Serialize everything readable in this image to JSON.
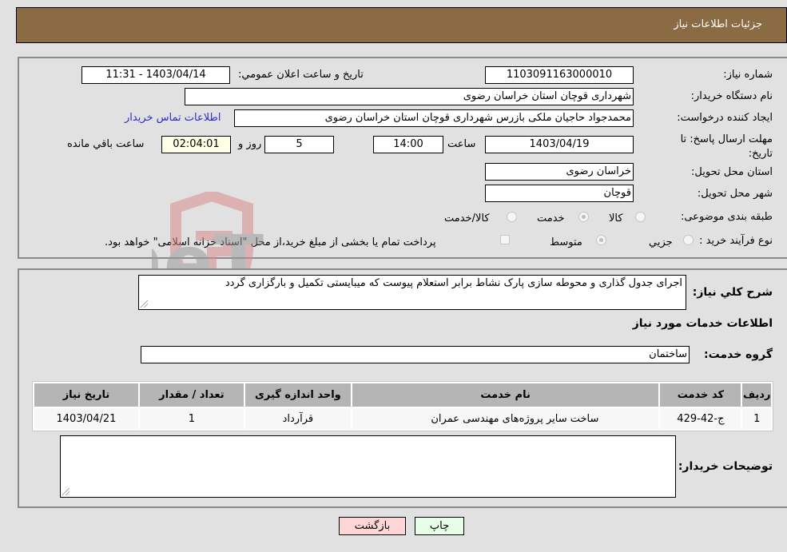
{
  "header": {
    "title": "جزئیات اطلاعات نیاز"
  },
  "details": {
    "need_number_label": "شماره نیاز:",
    "need_number": "1103091163000010",
    "announce_label": "تاریخ و ساعت اعلان عمومي:",
    "announce_value": "1403/04/14 - 11:31",
    "buyer_org_label": "نام دستگاه خریدار:",
    "buyer_org": "شهرداری قوچان استان خراسان رضوی",
    "creator_label": "ایجاد کننده درخواست:",
    "creator": "محمدجواد حاجیان ملکی بازرس شهرداری قوچان استان خراسان رضوی",
    "contact_link": "اطلاعات تماس خریدار",
    "deadline_label": "مهلت ارسال پاسخ: تا تاریخ:",
    "deadline_date": "1403/04/19",
    "time_label": "ساعت",
    "deadline_time": "14:00",
    "days_value": "5",
    "days_label": "روز و",
    "remaining_time": "02:04:01",
    "remaining_label": "ساعت باقي مانده",
    "province_label": "استان محل تحویل:",
    "province": "خراسان رضوی",
    "city_label": "شهر محل تحویل:",
    "city": "قوچان",
    "category_label": "طبقه بندی موضوعی:",
    "category_options": [
      {
        "label": "کالا",
        "checked": false
      },
      {
        "label": "خدمت",
        "checked": true
      },
      {
        "label": "کالا/خدمت",
        "checked": false
      }
    ],
    "process_label": "نوع فرآیند خرید :",
    "process_options": [
      {
        "label": "جزيي",
        "checked": false
      },
      {
        "label": "متوسط",
        "checked": true
      }
    ],
    "treasury_checkbox_label": "پرداخت تمام یا بخشی از مبلغ خرید،از محل \"اسناد خزانه اسلامی\" خواهد بود.",
    "treasury_checked": false
  },
  "summary": {
    "description_label": "شرح کلي نیاز:",
    "description": "اجرای جدول گذاری و محوطه سازی پارک نشاط برابر استعلام پیوست که میبایستی تکمیل و بارگزاری گردد",
    "services_heading": "اطلاعات خدمات مورد نیاز",
    "service_group_label": "گروه خدمت:",
    "service_group": "ساختمان"
  },
  "table": {
    "headers": [
      "ردیف",
      "کد خدمت",
      "نام خدمت",
      "واحد اندازه گیری",
      "تعداد / مقدار",
      "تاریخ نیاز"
    ],
    "rows": [
      [
        "1",
        "ج-42-429",
        "ساخت سایر پروژه‌های مهندسی عمران",
        "قرآرداد",
        "1",
        "1403/04/21"
      ]
    ]
  },
  "buyer_notes": {
    "label": "توضیحات خریدار:",
    "value": ""
  },
  "buttons": {
    "print": "چاپ",
    "back": "بازگشت"
  },
  "watermark": {
    "text": "AriaTender.neT"
  }
}
